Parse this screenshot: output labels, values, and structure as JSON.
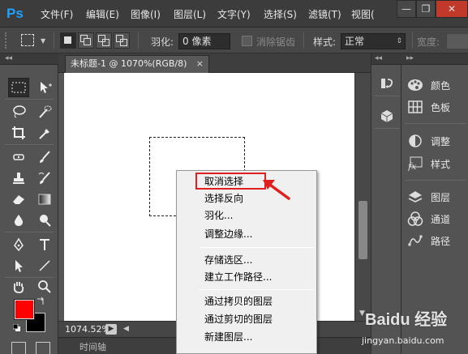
{
  "app": {
    "logo": "Ps"
  },
  "menubar": {
    "items": [
      {
        "label": "文件(F)"
      },
      {
        "label": "编辑(E)"
      },
      {
        "label": "图像(I)"
      },
      {
        "label": "图层(L)"
      },
      {
        "label": "文字(Y)"
      },
      {
        "label": "选择(S)"
      },
      {
        "label": "滤镜(T)"
      },
      {
        "label": "视图("
      }
    ],
    "window_controls": {
      "minimize": "—",
      "restore": "❐",
      "close": "✕"
    }
  },
  "options_bar": {
    "feather_label": "羽化:",
    "feather_value": "0 像素",
    "antialias_label": "消除锯齿",
    "style_label": "样式:",
    "style_value": "正常",
    "width_label": "宽度:"
  },
  "document": {
    "tab_title": "未标题-1 @ 1070%(RGB/8)",
    "tab_close": "×",
    "zoom": "1074.52%",
    "timeline_label": "时间轴"
  },
  "context_menu": {
    "groups": [
      [
        "取消选择",
        "选择反向",
        "羽化...",
        "调整边缘..."
      ],
      [
        "存储选区...",
        "建立工作路径..."
      ],
      [
        "通过拷贝的图层",
        "通过剪切的图层",
        "新建图层..."
      ]
    ],
    "highlighted": "取消选择"
  },
  "panels": [
    {
      "label": "颜色",
      "icon": "color-palette-icon"
    },
    {
      "label": "色板",
      "icon": "swatches-grid-icon"
    },
    {
      "label": "调整",
      "icon": "adjustments-icon"
    },
    {
      "label": "样式",
      "icon": "styles-fx-icon"
    },
    {
      "label": "图层",
      "icon": "layers-icon"
    },
    {
      "label": "通道",
      "icon": "channels-icon"
    },
    {
      "label": "路径",
      "icon": "paths-icon"
    }
  ],
  "colors": {
    "foreground": "#ff0000",
    "background": "#000000",
    "highlight_border": "#e01f1f",
    "ps_logo": "#1ea2ff"
  },
  "watermark": {
    "brand": "Baidu 经验",
    "url": "jingyan.baidu.com"
  }
}
